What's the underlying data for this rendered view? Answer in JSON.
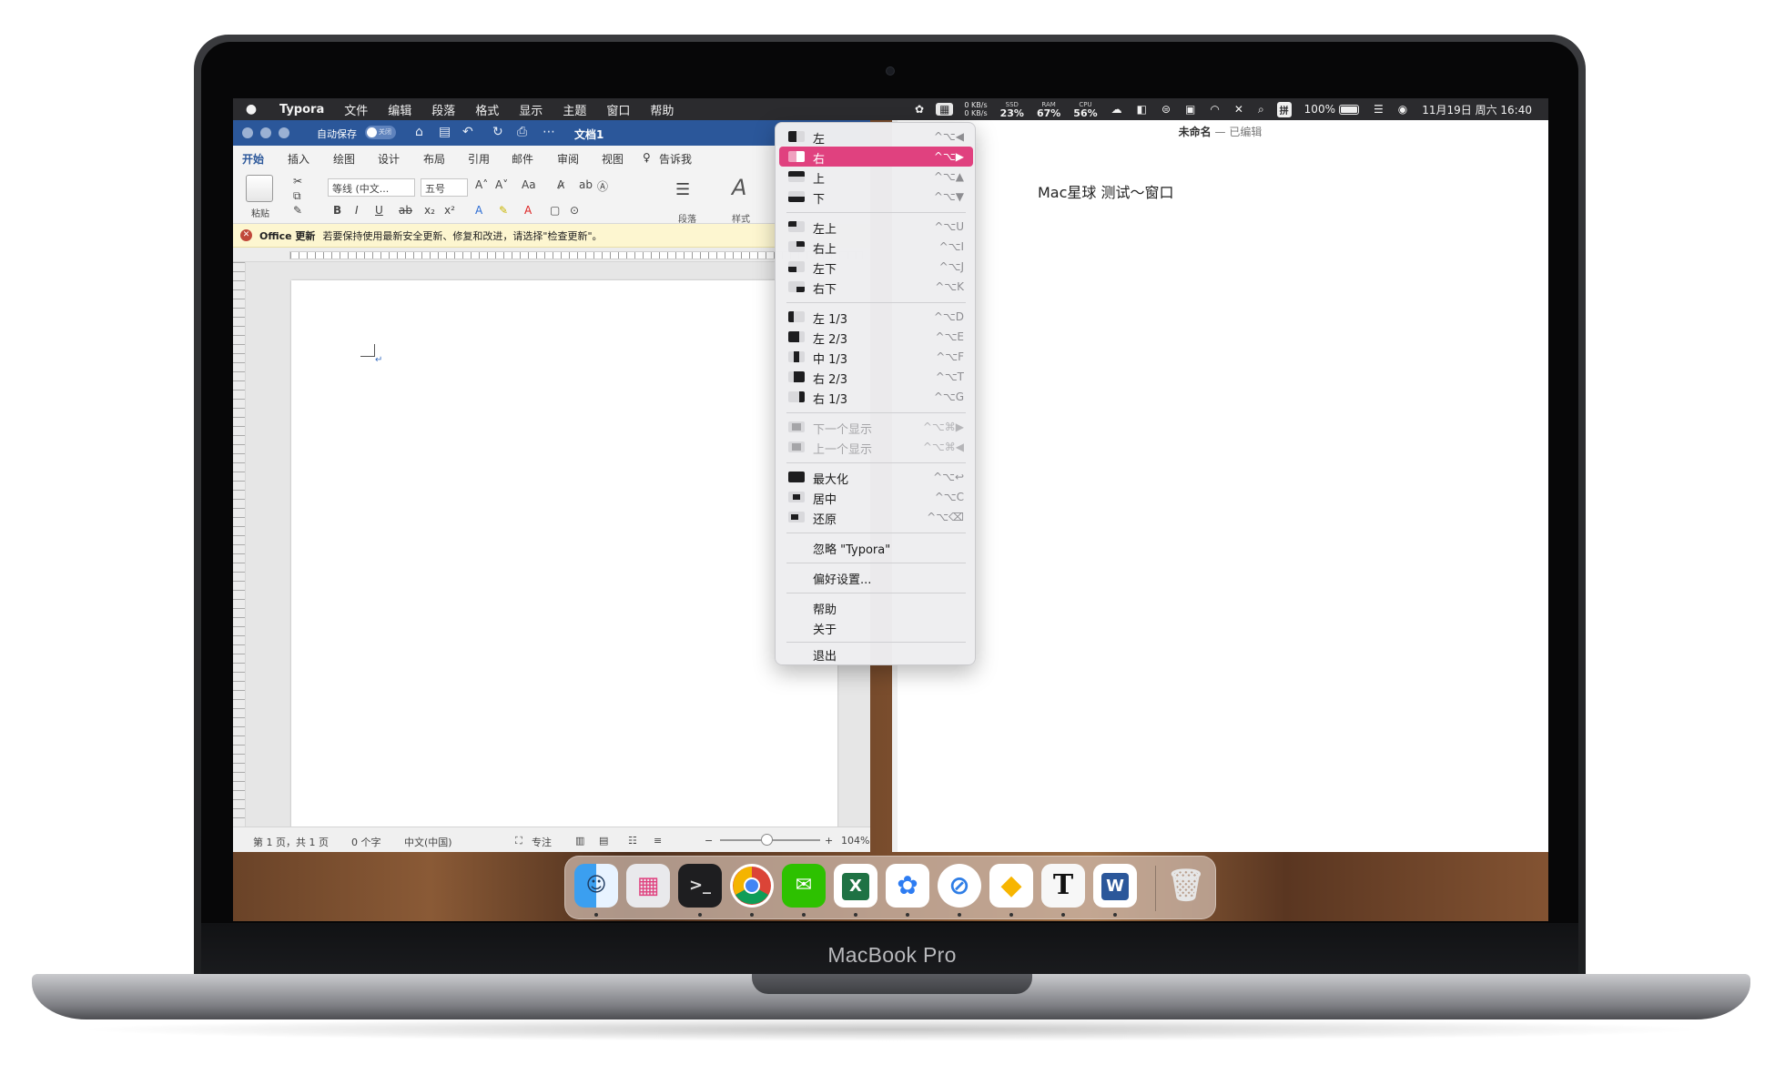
{
  "device": {
    "label": "MacBook Pro"
  },
  "menubar": {
    "app": "Typora",
    "items": [
      "文件",
      "编辑",
      "段落",
      "格式",
      "显示",
      "主题",
      "窗口",
      "帮助"
    ],
    "net": {
      "up": "0 KB/s",
      "down": "0 KB/s"
    },
    "ssd": {
      "label": "SSD",
      "value": "23%"
    },
    "ram": {
      "label": "RAM",
      "value": "67%"
    },
    "cpu": {
      "label": "CPU",
      "value": "56%"
    },
    "ime": "拼",
    "battery": "100%",
    "datetime": "11月19日 周六  16:40"
  },
  "word": {
    "autosave_label": "自动保存",
    "autosave_state": "关闭",
    "doc_title": "文档1",
    "tabs": [
      "开始",
      "插入",
      "绘图",
      "设计",
      "布局",
      "引用",
      "邮件",
      "审阅",
      "视图",
      "告诉我"
    ],
    "paste_label": "粘贴",
    "font_name": "等线 (中文...",
    "font_size": "五号",
    "paragraph_label": "段落",
    "styles_label": "样式",
    "update_bar": {
      "title": "Office 更新",
      "message": "若要保持使用最新安全更新、修复和改进，请选择\"检查更新\"。"
    },
    "status": {
      "page": "第 1 页，共 1 页",
      "words": "0 个字",
      "language": "中文(中国)",
      "focus": "专注",
      "zoom": "104%"
    }
  },
  "typora": {
    "doc_name": "未命名",
    "doc_state": "— 已编辑",
    "content": "Mac星球 测试～窗口"
  },
  "rect_menu": {
    "items": [
      {
        "label": "左",
        "shortcut": "^⌥◀"
      },
      {
        "label": "右",
        "shortcut": "^⌥▶"
      },
      {
        "label": "上",
        "shortcut": "^⌥▲"
      },
      {
        "label": "下",
        "shortcut": "^⌥▼"
      },
      {
        "label": "左上",
        "shortcut": "^⌥U"
      },
      {
        "label": "右上",
        "shortcut": "^⌥I"
      },
      {
        "label": "左下",
        "shortcut": "^⌥J"
      },
      {
        "label": "右下",
        "shortcut": "^⌥K"
      },
      {
        "label": "左 1/3",
        "shortcut": "^⌥D"
      },
      {
        "label": "左 2/3",
        "shortcut": "^⌥E"
      },
      {
        "label": "中 1/3",
        "shortcut": "^⌥F"
      },
      {
        "label": "右 2/3",
        "shortcut": "^⌥T"
      },
      {
        "label": "右 1/3",
        "shortcut": "^⌥G"
      },
      {
        "label": "下一个显示",
        "shortcut": "^⌥⌘▶"
      },
      {
        "label": "上一个显示",
        "shortcut": "^⌥⌘◀"
      },
      {
        "label": "最大化",
        "shortcut": "^⌥↩"
      },
      {
        "label": "居中",
        "shortcut": "^⌥C"
      },
      {
        "label": "还原",
        "shortcut": "^⌥⌫"
      },
      {
        "label": "忽略 \"Typora\"",
        "shortcut": ""
      },
      {
        "label": "偏好设置...",
        "shortcut": ""
      },
      {
        "label": "帮助",
        "shortcut": ""
      },
      {
        "label": "关于",
        "shortcut": ""
      },
      {
        "label": "退出",
        "shortcut": ""
      }
    ],
    "highlight_color": "#e0417f"
  },
  "dock": {
    "apps": [
      "finder-icon",
      "launchpad-icon",
      "terminal-icon",
      "chrome-icon",
      "wechat-icon",
      "excel-icon",
      "baidunetdisk-icon",
      "safari-icon",
      "sketch-icon",
      "typora-icon",
      "word-icon",
      "trash-icon"
    ],
    "text": {
      "terminal": ">_",
      "typora": "T",
      "word": "W",
      "excel": "X"
    }
  }
}
